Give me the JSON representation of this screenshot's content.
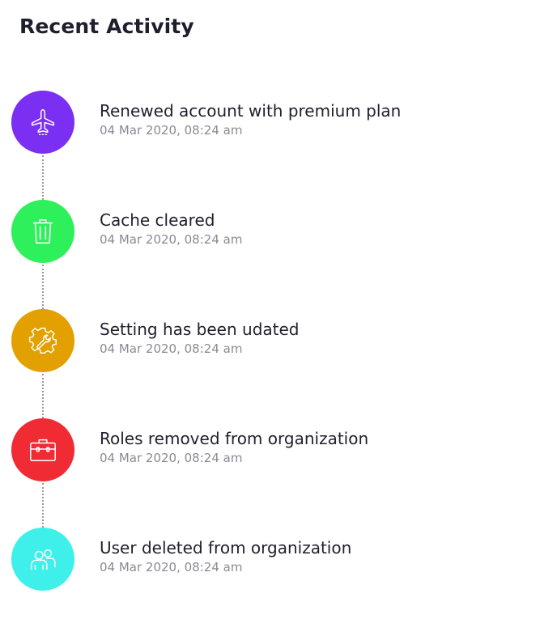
{
  "header": {
    "title": "Recent Activity"
  },
  "activities": [
    {
      "icon": "airplane-icon",
      "color": "#7b2ff2",
      "title": "Renewed account with premium plan",
      "time": "04 Mar 2020, 08:24 am"
    },
    {
      "icon": "trash-icon",
      "color": "#2ef05a",
      "title": "Cache cleared",
      "time": "04 Mar 2020, 08:24 am"
    },
    {
      "icon": "gear-wrench-icon",
      "color": "#e2a100",
      "title": "Setting has been udated",
      "time": "04 Mar 2020, 08:24 am"
    },
    {
      "icon": "briefcase-icon",
      "color": "#f02b33",
      "title": "Roles removed from organization",
      "time": "04 Mar 2020, 08:24 am"
    },
    {
      "icon": "users-icon",
      "color": "#3ff0ea",
      "title": "User deleted from organization",
      "time": "04 Mar 2020, 08:24 am"
    }
  ]
}
